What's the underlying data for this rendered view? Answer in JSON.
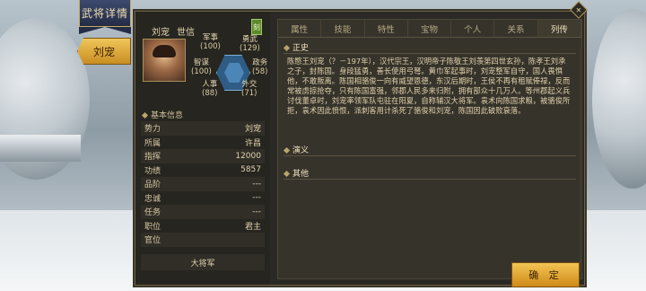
{
  "banner": {
    "title": "武将详情"
  },
  "side": {
    "name_tab": "刘宠"
  },
  "hero": {
    "name": "刘宠",
    "rank": "世信",
    "badge": "刻",
    "stats": {
      "military_label": "军事",
      "military_value": "(100)",
      "valor_label": "勇武",
      "valor_value": "(129)",
      "intellect_label": "智谋",
      "intellect_value": "(100)",
      "politics_label": "政务",
      "politics_value": "(58)",
      "personnel_label": "人事",
      "personnel_value": "(88)",
      "diplomacy_label": "外交",
      "diplomacy_value": "(71)"
    }
  },
  "basic": {
    "heading": "基本信息",
    "rows": [
      {
        "label": "势力",
        "value": "刘宠"
      },
      {
        "label": "所属",
        "value": "许昌"
      },
      {
        "label": "指挥",
        "value": "12000"
      },
      {
        "label": "功绩",
        "value": "5857"
      },
      {
        "label": "品阶",
        "value": "---"
      },
      {
        "label": "忠诚",
        "value": "---"
      },
      {
        "label": "任务",
        "value": "---"
      },
      {
        "label": "职位",
        "value": "君主"
      },
      {
        "label": "官位",
        "value": ""
      }
    ],
    "general_title": "大将军"
  },
  "tabs": [
    "属性",
    "技能",
    "特性",
    "宝物",
    "个人",
    "关系",
    "列传"
  ],
  "biography": {
    "official_title": "正史",
    "official_text": "陈愍王刘宠（？－197年），汉代宗王，汉明帝子陈敬王刘羡第四世玄孙，陈孝王刘承之子，封陈国。身段猛勇，善长使用弓弩。黄巾军起事时，刘宠整军自守，国人畏惧他，不敢叛离。陈国相骆俊一向有威望恩德，东汉后期时，王侯不再有租赋俸禄，反而常被虏掠抢夺，只有陈国富强，邻郡人民多来归附，拥有部众十几万人。等州郡起义兵讨伐董卓时，刘宠率领军队屯驻在阳夏，自称辅汉大将军。袁术向陈国求粮，被骆俊所拒，袁术因此愤恨，派刺客用计杀死了骆俊和刘宠，陈国因此破败衰落。",
    "romance_title": "演义",
    "other_title": "其他"
  },
  "buttons": {
    "confirm": "确 定",
    "close": "✕"
  }
}
